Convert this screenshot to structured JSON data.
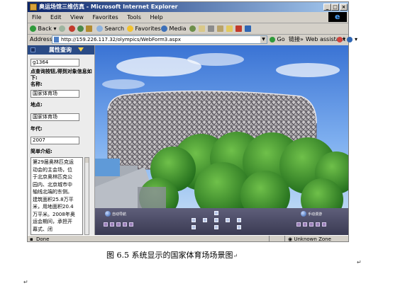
{
  "window": {
    "title": "奥运场馆三维仿真 - Microsoft Internet Explorer",
    "controls": [
      "_",
      "□",
      "×"
    ]
  },
  "menu": [
    "File",
    "Edit",
    "View",
    "Favorites",
    "Tools",
    "Help"
  ],
  "toolbar": {
    "back": "Back",
    "search": "Search",
    "favorites": "Favorites",
    "media": "Media"
  },
  "addressbar": {
    "label": "Address",
    "url": "http://159.226.117.32/olympics/WebForm3.aspx",
    "go": "Go",
    "links": "链接",
    "web_assistant": "Web assistant"
  },
  "sidebar": {
    "header": "属性查询",
    "id_value": "g1364",
    "instructions": "点查询按钮,得到对象信息如下:",
    "name_label": "名称:",
    "name_value": "国家体育场",
    "location_label": "地点:",
    "location_value": "国家体育场",
    "year_label": "年代:",
    "year_value": "2007",
    "intro_label": "简单介绍:",
    "intro_text": "第29届奥林匹克运动会的主会场，位于北京奥林匹克公园内、北京城市中轴线北端的东侧。建筑面积25.8万平米，用地面积20.4万平米。2008年奥运会期间，承担开幕式、闭"
  },
  "navigation": {
    "left_label": "自动导航",
    "right_label": "手动漫游"
  },
  "statusbar": {
    "status": "Done",
    "zone": "Unknown Zone"
  },
  "caption": {
    "text": "图 6.5  系统显示的国家体育场场景图",
    "return_mark": "↵"
  },
  "colors": {
    "titlebar": "#0a246a",
    "sidebar_header": "#2a4b86",
    "nav_panel": "#4a4a66",
    "sky": "#5a8ee0"
  }
}
